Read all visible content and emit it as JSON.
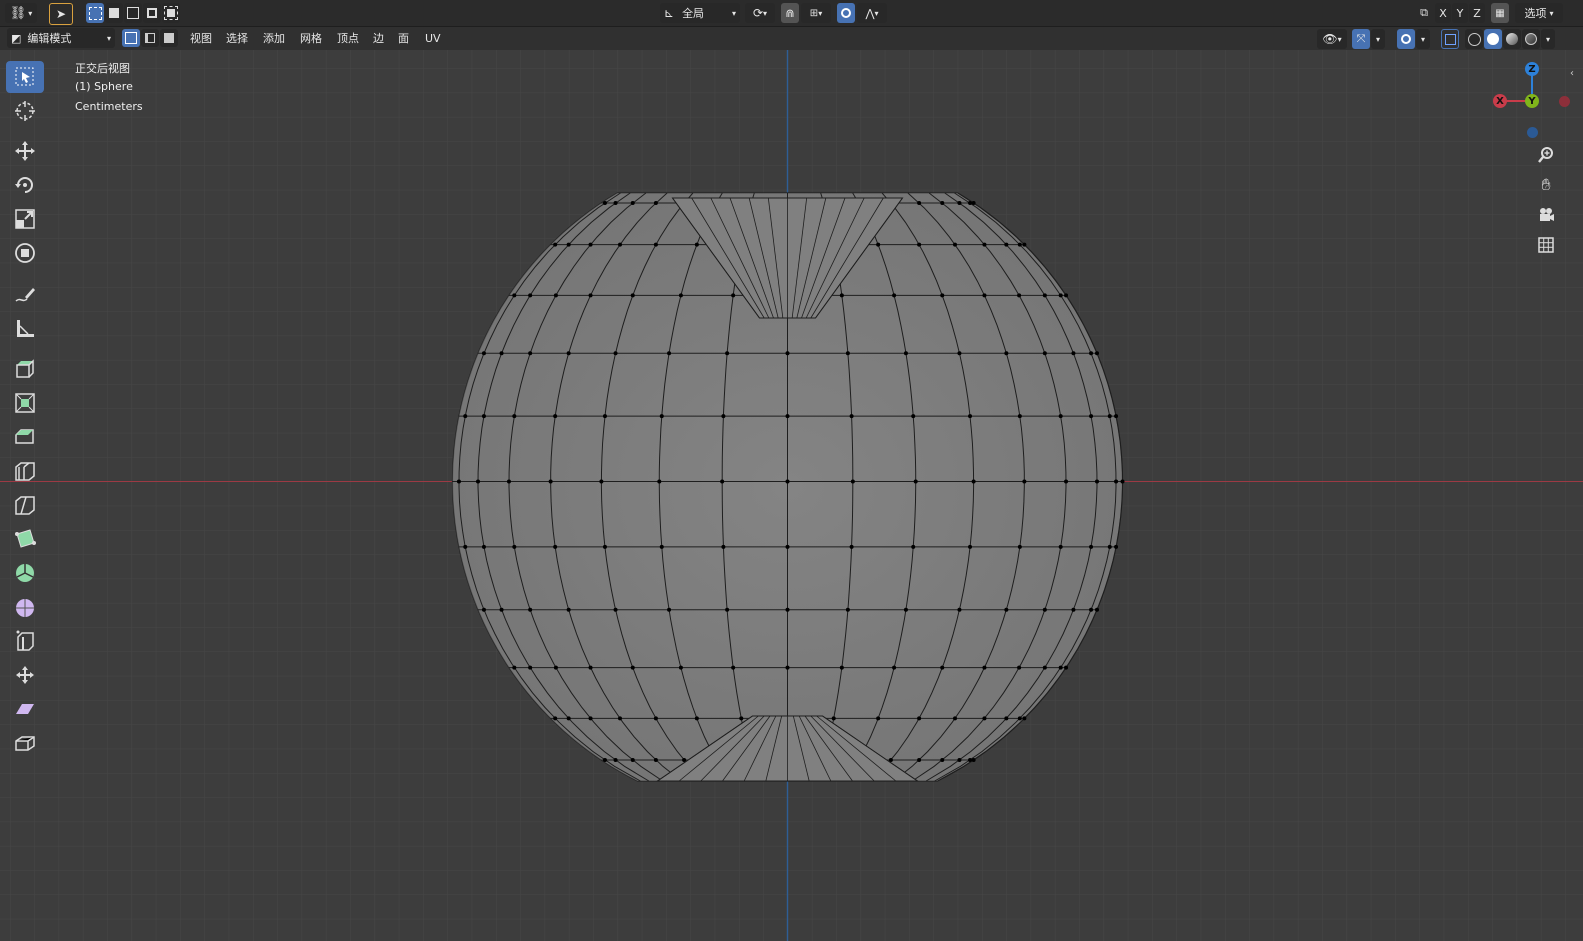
{
  "topbar": {
    "transform_orientation": "全局",
    "axis_x": "X",
    "axis_y": "Y",
    "axis_z": "Z",
    "options": "选项"
  },
  "header": {
    "mode": "编辑模式",
    "menus": [
      "视图",
      "选择",
      "添加",
      "网格",
      "顶点",
      "边",
      "面",
      "UV"
    ]
  },
  "viewport": {
    "view_name": "正交后视图",
    "object_name": "(1) Sphere",
    "units": "Centimeters",
    "gizmo": {
      "x": "X",
      "y": "Y",
      "z": "Z"
    }
  },
  "colors": {
    "accent": "#4772b3",
    "x_axis": "#c93c4a",
    "y_axis": "#80b51b",
    "z_axis": "#2d81d9",
    "background": "#3d3d3d",
    "mesh": "#7d7d7d"
  },
  "tools": [
    "select-box-icon",
    "cursor-icon",
    "move-icon",
    "rotate-icon",
    "scale-icon",
    "transform-icon",
    "annotate-icon",
    "measure-icon",
    "extrude-region-icon",
    "inset-faces-icon",
    "bevel-icon",
    "loop-cut-icon",
    "knife-icon",
    "poly-build-icon",
    "spin-icon",
    "smooth-icon",
    "edge-slide-icon",
    "shrink-fatten-icon",
    "shear-icon",
    "rip-region-icon"
  ]
}
